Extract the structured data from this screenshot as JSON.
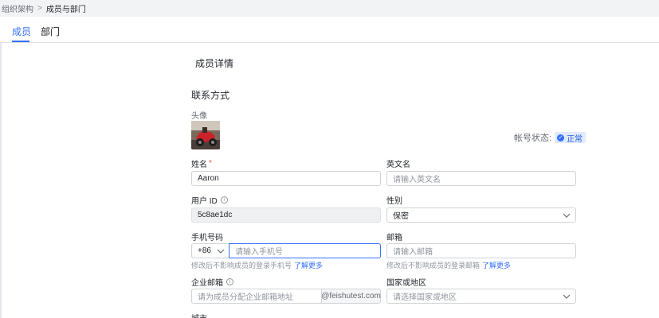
{
  "breadcrumb": {
    "parent": "组织架构",
    "separator": ">",
    "current": "成员与部门"
  },
  "tabs": [
    {
      "label": "成员"
    },
    {
      "label": "部门"
    }
  ],
  "page_title": "成员详情",
  "section_title": "联系方式",
  "avatar_label": "头像",
  "account": {
    "label": "帐号状态:",
    "status": "正常",
    "status_icon": "check-circle-icon"
  },
  "fields": {
    "name": {
      "label": "姓名",
      "required": "*",
      "value": "Aaron"
    },
    "english_name": {
      "label": "英文名",
      "placeholder": "请输入英文名"
    },
    "user_id": {
      "label": "用户 ID",
      "value": "5c8ae1dc"
    },
    "gender": {
      "label": "性别",
      "value": "保密"
    },
    "phone": {
      "label": "手机号码",
      "prefix": "+86",
      "placeholder": "请输入手机号",
      "hint": "修改后不影响成员的登录手机号",
      "hint_link": "了解更多"
    },
    "email": {
      "label": "邮箱",
      "placeholder": "请输入邮箱",
      "hint": "修改后不影响成员的登录邮箱",
      "hint_link": "了解更多"
    },
    "enterprise_email": {
      "label": "企业邮箱",
      "placeholder": "请为成员分配企业邮箱地址",
      "suffix": "@feishutest.com"
    },
    "region": {
      "label": "国家或地区",
      "placeholder": "请选择国家或地区"
    },
    "city": {
      "label": "城市"
    }
  },
  "colors": {
    "accent": "#3370ff",
    "required": "#f54a45"
  }
}
